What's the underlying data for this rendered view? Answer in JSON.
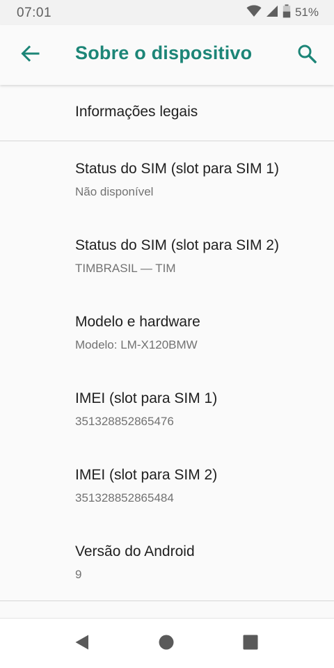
{
  "status_bar": {
    "time": "07:01",
    "battery_percent": "51%",
    "battery_level": 0.51,
    "icons": [
      "wifi-icon",
      "cell-signal-icon",
      "battery-icon"
    ]
  },
  "app_bar": {
    "title": "Sobre o dispositivo",
    "accent_color": "#1c8577",
    "back_icon": "arrow-back-icon",
    "search_icon": "search-icon"
  },
  "legal": {
    "title": "Informações legais"
  },
  "items": [
    {
      "title": "Status do SIM (slot para SIM 1)",
      "summary": "Não disponível"
    },
    {
      "title": "Status do SIM (slot para SIM 2)",
      "summary": "TIMBRASIL — TIM"
    },
    {
      "title": "Modelo e hardware",
      "summary": "Modelo: LM-X120BMW"
    },
    {
      "title": "IMEI (slot para SIM 1)",
      "summary": "351328852865476"
    },
    {
      "title": "IMEI (slot para SIM 2)",
      "summary": "351328852865484"
    },
    {
      "title": "Versão do Android",
      "summary": "9"
    }
  ],
  "nav_bar": {
    "icons": [
      "back-triangle-icon",
      "home-circle-icon",
      "recents-square-icon"
    ]
  }
}
